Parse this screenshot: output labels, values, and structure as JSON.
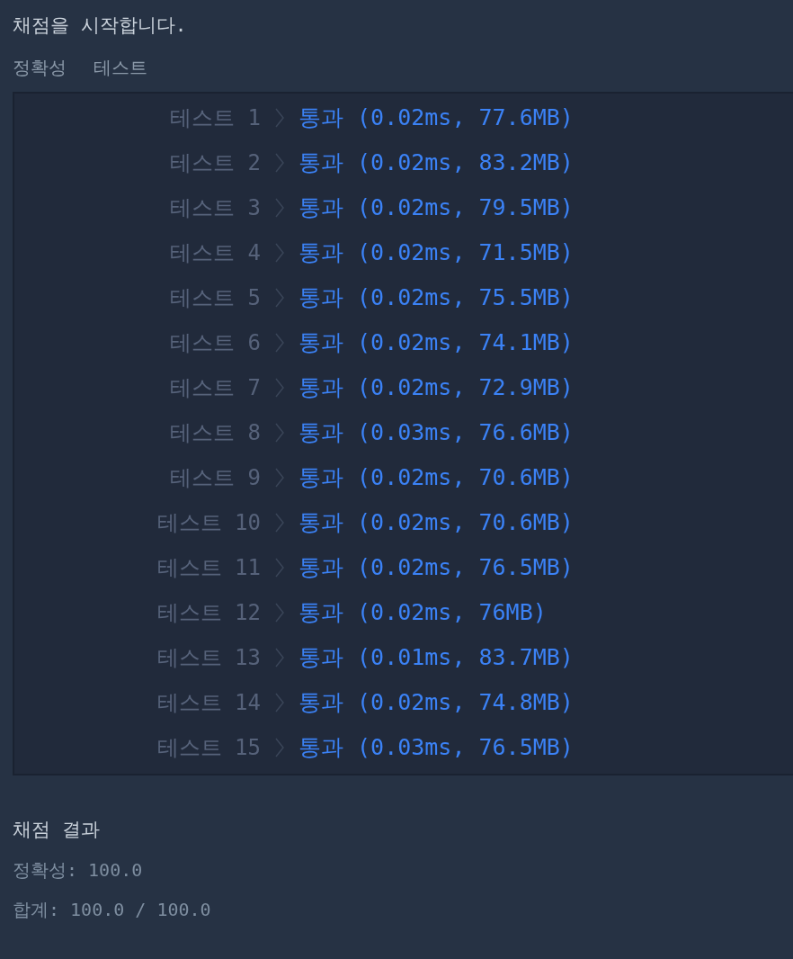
{
  "title": "채점을 시작합니다.",
  "section_labels": [
    "정확성",
    "테스트"
  ],
  "tests": [
    {
      "label": "테스트 1",
      "result": "통과 (0.02ms, 77.6MB)"
    },
    {
      "label": "테스트 2",
      "result": "통과 (0.02ms, 83.2MB)"
    },
    {
      "label": "테스트 3",
      "result": "통과 (0.02ms, 79.5MB)"
    },
    {
      "label": "테스트 4",
      "result": "통과 (0.02ms, 71.5MB)"
    },
    {
      "label": "테스트 5",
      "result": "통과 (0.02ms, 75.5MB)"
    },
    {
      "label": "테스트 6",
      "result": "통과 (0.02ms, 74.1MB)"
    },
    {
      "label": "테스트 7",
      "result": "통과 (0.02ms, 72.9MB)"
    },
    {
      "label": "테스트 8",
      "result": "통과 (0.03ms, 76.6MB)"
    },
    {
      "label": "테스트 9",
      "result": "통과 (0.02ms, 70.6MB)"
    },
    {
      "label": "테스트 10",
      "result": "통과 (0.02ms, 70.6MB)"
    },
    {
      "label": "테스트 11",
      "result": "통과 (0.02ms, 76.5MB)"
    },
    {
      "label": "테스트 12",
      "result": "통과 (0.02ms, 76MB)"
    },
    {
      "label": "테스트 13",
      "result": "통과 (0.01ms, 83.7MB)"
    },
    {
      "label": "테스트 14",
      "result": "통과 (0.02ms, 74.8MB)"
    },
    {
      "label": "테스트 15",
      "result": "통과 (0.03ms, 76.5MB)"
    }
  ],
  "summary_title": "채점 결과",
  "summary_lines": [
    "정확성: 100.0",
    "합계: 100.0 / 100.0"
  ]
}
